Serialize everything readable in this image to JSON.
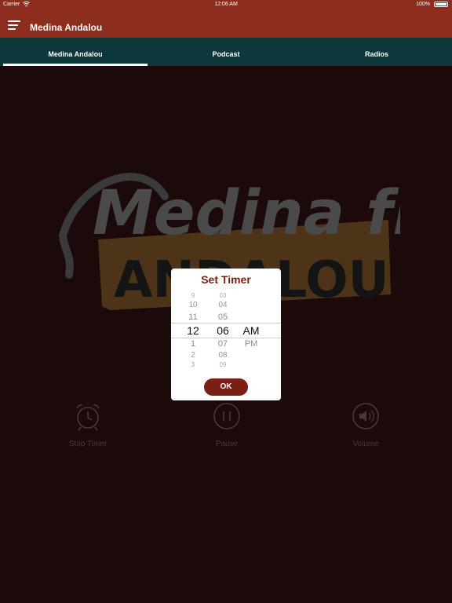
{
  "status_bar": {
    "carrier": "Carrier",
    "time": "12:06 AM",
    "battery": "100%"
  },
  "navbar": {
    "title": "Medina Andalou"
  },
  "tabs": [
    {
      "label": "Medina Andalou",
      "selected": true
    },
    {
      "label": "Podcast",
      "selected": false
    },
    {
      "label": "Radios",
      "selected": false
    }
  ],
  "logo": {
    "line1": "Medina fm",
    "line2": "ANDALOU"
  },
  "controls": {
    "stop_timer": "Stop Timer",
    "pause": "Pause",
    "volume": "Volume"
  },
  "timer_dialog": {
    "title": "Set Timer",
    "hours": [
      "9",
      "10",
      "11",
      "12",
      "1",
      "2",
      "3"
    ],
    "minutes": [
      "03",
      "04",
      "05",
      "06",
      "07",
      "08",
      "09"
    ],
    "periods": [
      "AM",
      "PM"
    ],
    "selected_hour": "12",
    "selected_minute": "06",
    "selected_period": "AM",
    "ok_label": "OK"
  },
  "colors": {
    "header": "#8c2d1e",
    "tabbar": "#0c373b",
    "background": "#1c0a0a",
    "accent": "#7a1f14"
  }
}
